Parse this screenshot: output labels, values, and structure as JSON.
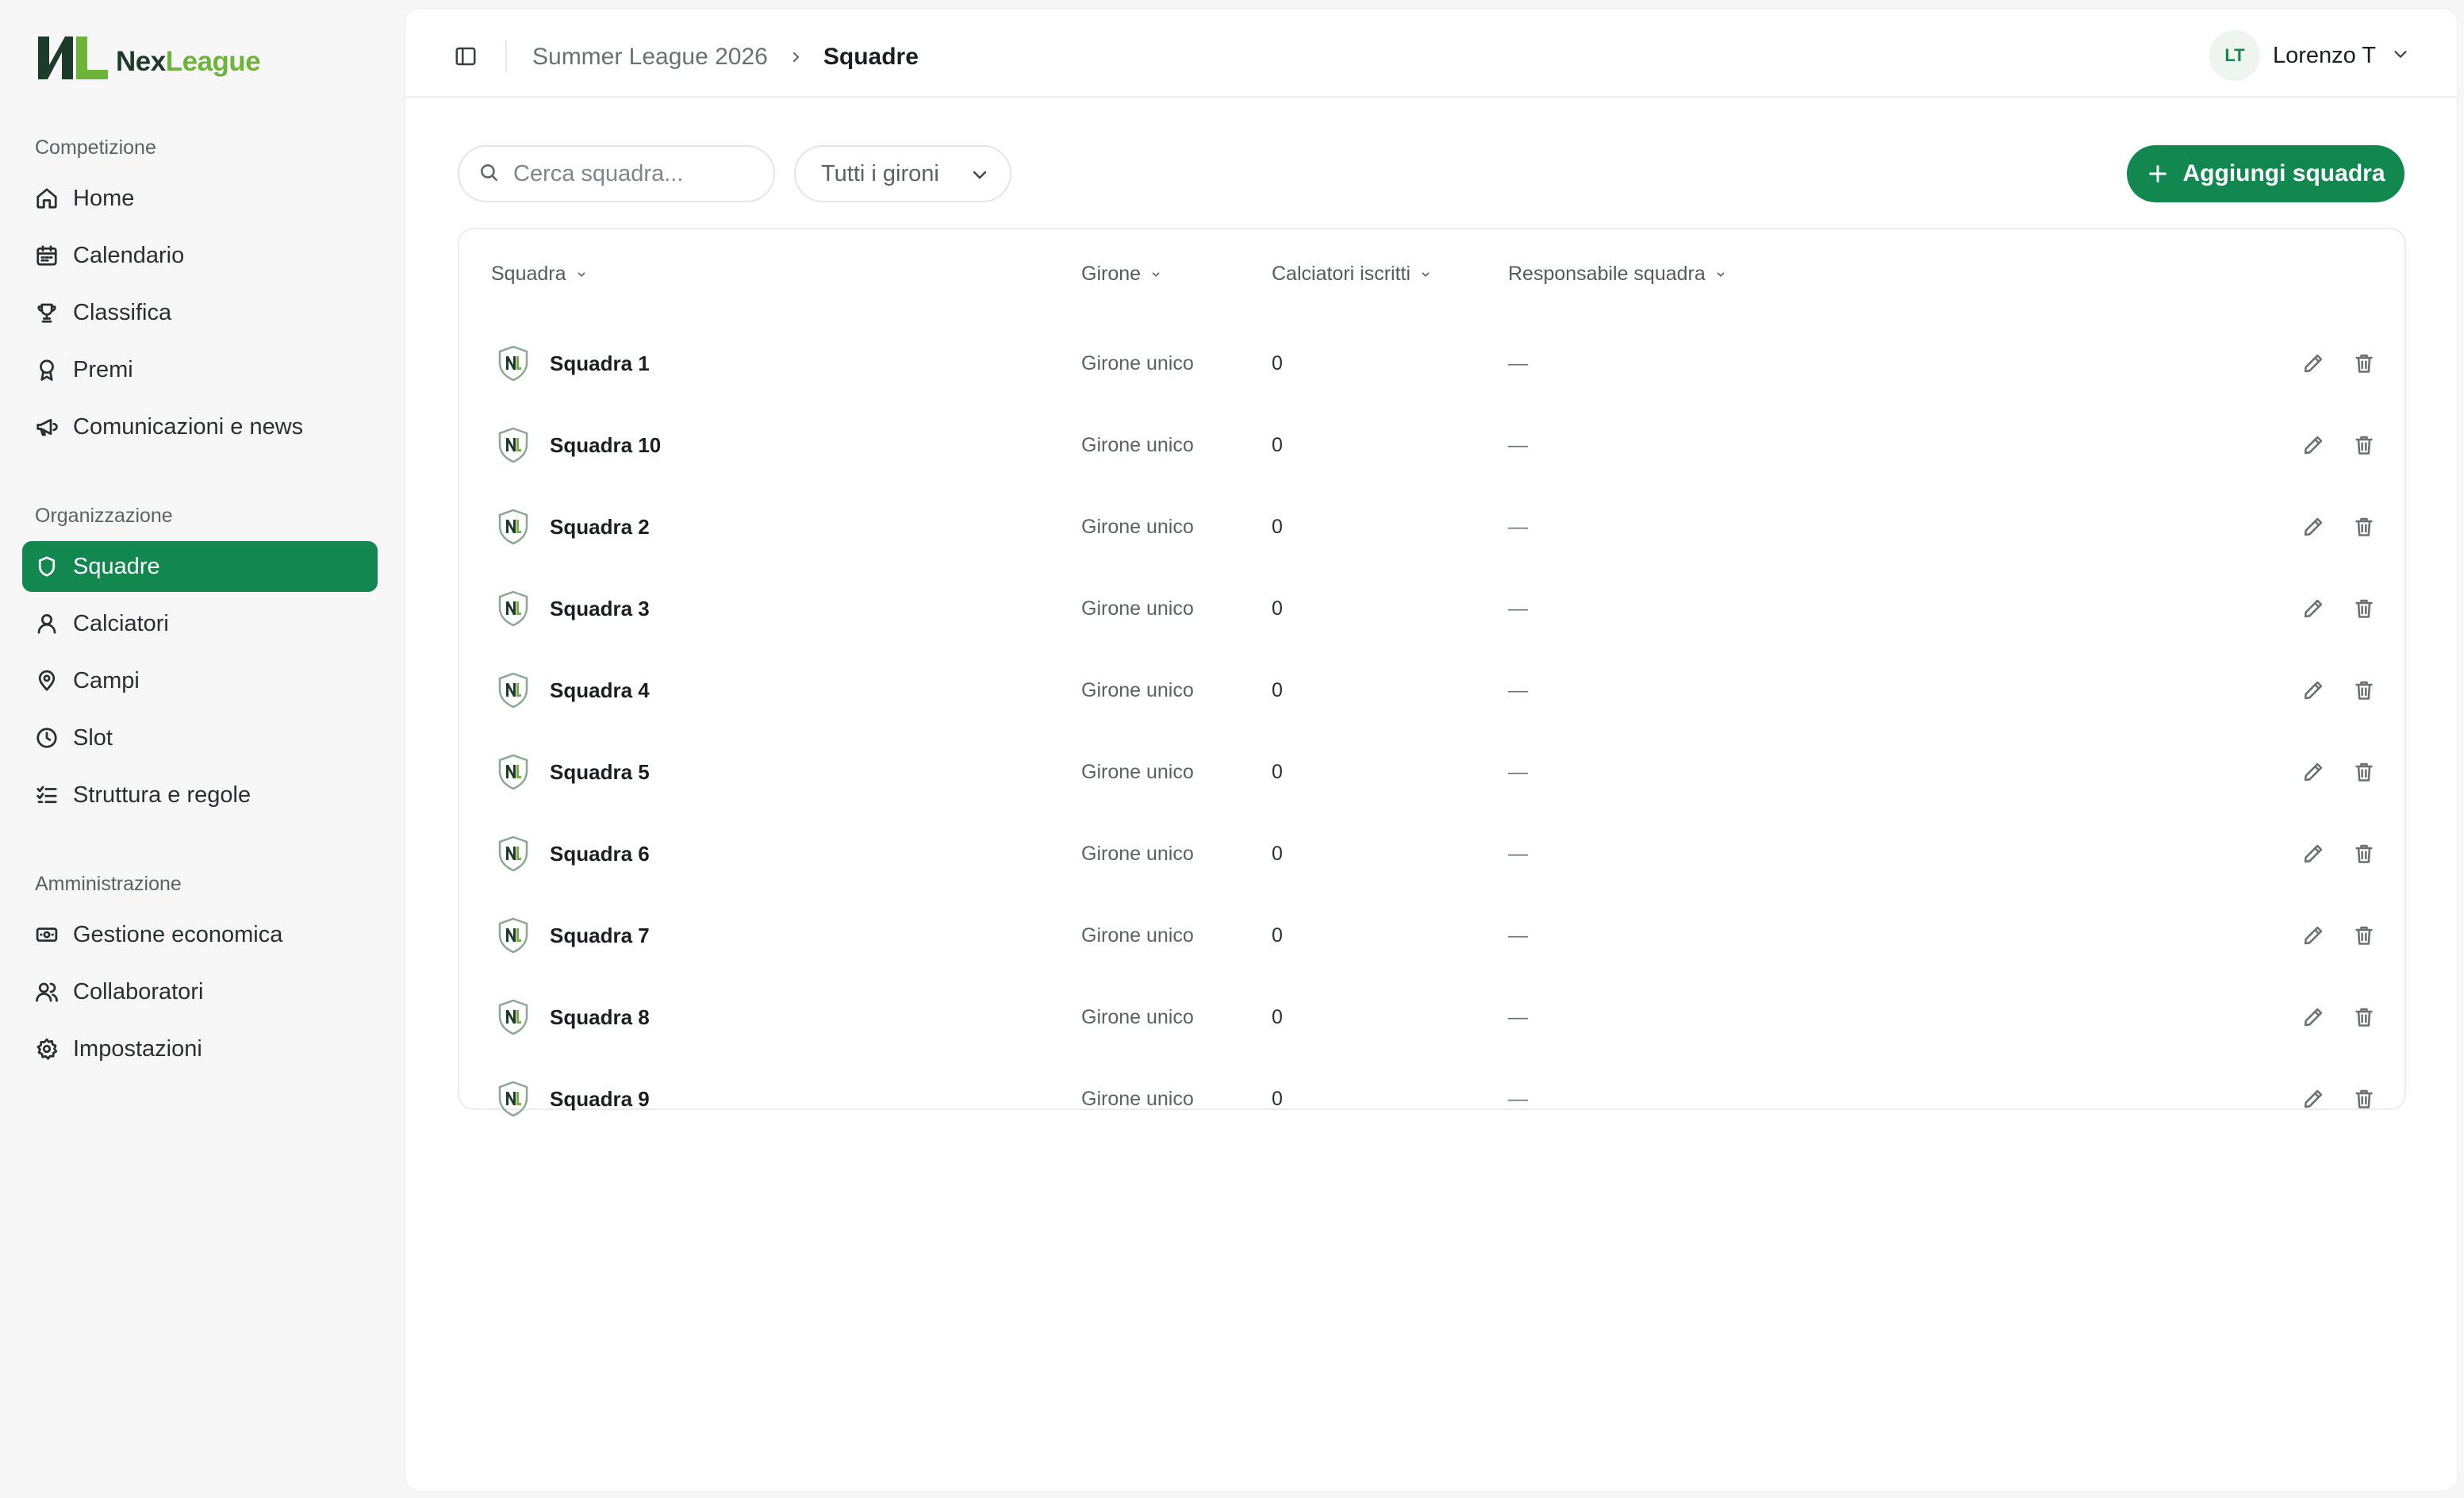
{
  "app": {
    "logo_nex": "Nex",
    "logo_league": "League",
    "brand_color": "#12874f"
  },
  "sidebar": {
    "sections": [
      {
        "label": "Competizione"
      },
      {
        "label": "Organizzazione"
      },
      {
        "label": "Amministrazione"
      }
    ],
    "items": [
      {
        "label": "Home",
        "icon": "home-icon"
      },
      {
        "label": "Calendario",
        "icon": "calendar-icon"
      },
      {
        "label": "Classifica",
        "icon": "trophy-icon"
      },
      {
        "label": "Premi",
        "icon": "award-icon"
      },
      {
        "label": "Comunicazioni e news",
        "icon": "megaphone-icon"
      },
      {
        "label": "Squadre",
        "icon": "shield-icon",
        "active": true
      },
      {
        "label": "Calciatori",
        "icon": "user-icon"
      },
      {
        "label": "Campi",
        "icon": "map-pin-icon"
      },
      {
        "label": "Slot",
        "icon": "clock-icon"
      },
      {
        "label": "Struttura e regole",
        "icon": "list-check-icon"
      },
      {
        "label": "Gestione economica",
        "icon": "banknote-icon"
      },
      {
        "label": "Collaboratori",
        "icon": "users-icon"
      },
      {
        "label": "Impostazioni",
        "icon": "gear-icon"
      }
    ]
  },
  "header": {
    "breadcrumb_parent": "Summer League 2026",
    "breadcrumb_current": "Squadre",
    "user_initials": "LT",
    "user_name": "Lorenzo T"
  },
  "toolbar": {
    "search_placeholder": "Cerca squadra...",
    "filter_value": "Tutti i gironi",
    "add_label": "Aggiungi squadra"
  },
  "table": {
    "columns": [
      "Squadra",
      "Girone",
      "Calciatori iscritti",
      "Responsabile squadra"
    ],
    "rows": [
      {
        "team": "Squadra 1",
        "girone": "Girone unico",
        "players": "0",
        "manager": "—"
      },
      {
        "team": "Squadra 10",
        "girone": "Girone unico",
        "players": "0",
        "manager": "—"
      },
      {
        "team": "Squadra 2",
        "girone": "Girone unico",
        "players": "0",
        "manager": "—"
      },
      {
        "team": "Squadra 3",
        "girone": "Girone unico",
        "players": "0",
        "manager": "—"
      },
      {
        "team": "Squadra 4",
        "girone": "Girone unico",
        "players": "0",
        "manager": "—"
      },
      {
        "team": "Squadra 5",
        "girone": "Girone unico",
        "players": "0",
        "manager": "—"
      },
      {
        "team": "Squadra 6",
        "girone": "Girone unico",
        "players": "0",
        "manager": "—"
      },
      {
        "team": "Squadra 7",
        "girone": "Girone unico",
        "players": "0",
        "manager": "—"
      },
      {
        "team": "Squadra 8",
        "girone": "Girone unico",
        "players": "0",
        "manager": "—"
      },
      {
        "team": "Squadra 9",
        "girone": "Girone unico",
        "players": "0",
        "manager": "—"
      }
    ]
  }
}
